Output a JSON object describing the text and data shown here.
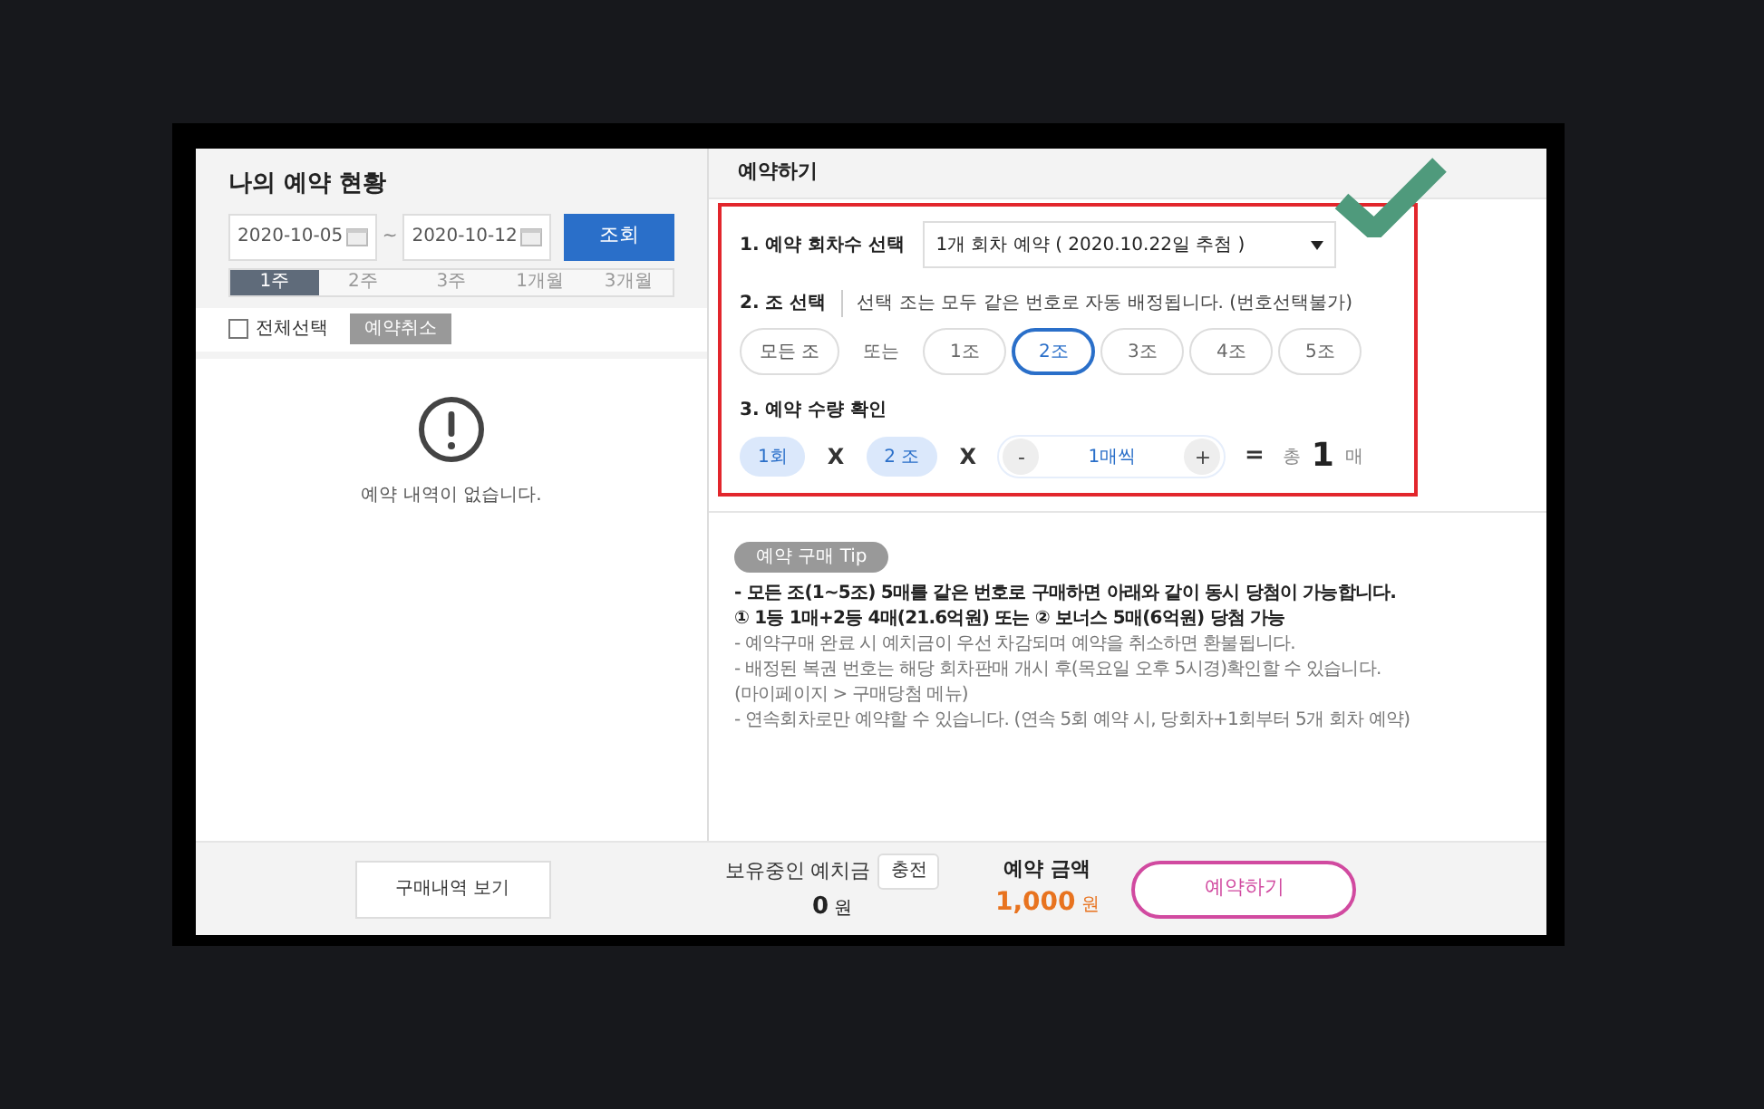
{
  "left_panel": {
    "title": "나의 예약 현황",
    "date_from": "2020-10-05",
    "date_separator": "~",
    "date_to": "2020-10-12",
    "search_button": "조회",
    "period_tabs": [
      {
        "label": "1주",
        "selected": true
      },
      {
        "label": "2주",
        "selected": false
      },
      {
        "label": "3주",
        "selected": false
      },
      {
        "label": "1개월",
        "selected": false
      },
      {
        "label": "3개월",
        "selected": false
      }
    ],
    "select_all": {
      "label": "전체선택",
      "checked": false
    },
    "cancel_button": "예약취소",
    "empty_message": "예약 내역이 없습니다."
  },
  "right_panel": {
    "title": "예약하기",
    "step1": {
      "label": "1. 예약 회차수 선택",
      "dropdown": "1개 회차 예약 ( 2020.10.22일 추첨 )"
    },
    "step2": {
      "label": "2. 조 선택",
      "hint": "선택 조는 모두 같은 번호로 자동 배정됩니다. (번호선택불가)",
      "all_button": "모든 조",
      "or_text": "또는",
      "groups": [
        {
          "label": "1조",
          "selected": false
        },
        {
          "label": "2조",
          "selected": true
        },
        {
          "label": "3조",
          "selected": false
        },
        {
          "label": "4조",
          "selected": false
        },
        {
          "label": "5조",
          "selected": false
        }
      ]
    },
    "step3": {
      "label": "3. 예약 수량 확인",
      "rounds": "1회",
      "times_1": "X",
      "group_count": "2 조",
      "times_2": "X",
      "minus": "-",
      "quantity": "1매씩",
      "plus": "+",
      "equals": "=",
      "total_prefix": "총",
      "total": "1",
      "total_unit": "매"
    },
    "tip": {
      "badge": "예약 구매 Tip",
      "lines": [
        {
          "kind": "bold",
          "text": "- 모든 조(1~5조) 5매를 같은 번호로 구매하면 아래와 같이 동시 당첨이 가능합니다."
        },
        {
          "kind": "bold",
          "text": "① 1등 1매+2등 4매(21.6억원) 또는 ② 보너스 5매(6억원) 당첨 가능"
        },
        {
          "kind": "normal",
          "text": "- 예약구매 완료 시 예치금이 우선 차감되며 예약을 취소하면 환불됩니다."
        },
        {
          "kind": "normal",
          "text": "- 배정된 복권 번호는 해당 회차판매 개시 후(목요일 오후 5시경)확인할 수 있습니다."
        },
        {
          "kind": "normal",
          "text": "(마이페이지 > 구매당첨 메뉴)"
        },
        {
          "kind": "normal",
          "text": "- 연속회차로만 예약할 수 있습니다. (연속 5회 예약 시, 당회차+1회부터 5개 회차 예약)"
        }
      ]
    }
  },
  "footer": {
    "history_button": "구매내역 보기",
    "deposit_label": "보유중인 예치금",
    "charge_button": "충전",
    "deposit_amount": "0",
    "deposit_unit": "원",
    "amount_label": "예약 금액",
    "amount": "1,000",
    "amount_unit": "원",
    "reserve_button": "예약하기"
  }
}
